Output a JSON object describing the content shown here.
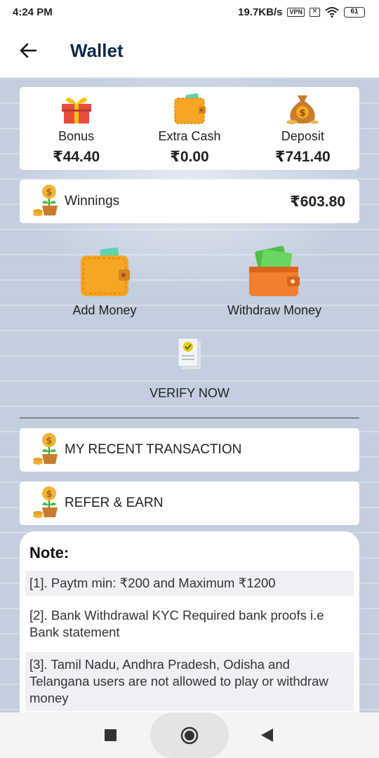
{
  "status_bar": {
    "time": "4:24 PM",
    "speed": "19.7KB/s",
    "vpn": "VPN",
    "battery": "61"
  },
  "header": {
    "title": "Wallet"
  },
  "balances": [
    {
      "label": "Bonus",
      "value": "₹44.40",
      "icon": "gift-icon"
    },
    {
      "label": "Extra Cash",
      "value": "₹0.00",
      "icon": "wallet-icon"
    },
    {
      "label": "Deposit",
      "value": "₹741.40",
      "icon": "money-bag-icon"
    }
  ],
  "winnings": {
    "label": "Winnings",
    "value": "₹603.80",
    "icon": "coin-plant-icon"
  },
  "actions": {
    "add_money": "Add Money",
    "withdraw_money": "Withdraw Money",
    "verify_now": "VERIFY NOW"
  },
  "menu": {
    "recent_transaction": "MY RECENT TRANSACTION",
    "refer_earn": "REFER & EARN"
  },
  "note": {
    "title": "Note:",
    "items": [
      "[1]. Paytm min: ₹200 and Maximum ₹1200",
      "[2]. Bank Withdrawal KYC Required bank proofs i.e Bank statement",
      "[3]. Tamil Nadu, Andhra Pradesh, Odisha and Telangana users are not allowed to play or withdraw money"
    ]
  },
  "colors": {
    "title": "#0f2a44",
    "background": "#b8c4d6",
    "accent_orange": "#f0a030",
    "accent_green": "#4fbf4a"
  }
}
